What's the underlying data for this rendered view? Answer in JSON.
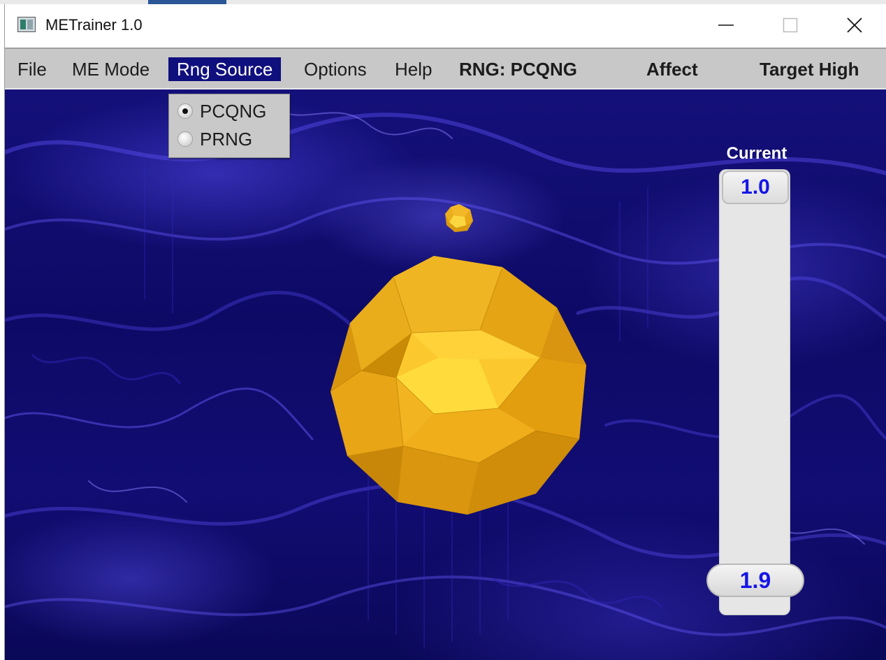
{
  "window": {
    "title": "METrainer 1.0"
  },
  "menu": {
    "items": [
      "File",
      "ME Mode",
      "Rng Source",
      "Options",
      "Help"
    ],
    "active": "Rng Source"
  },
  "status": {
    "rng": "RNG: PCQNG",
    "mode": "Affect",
    "target": "Target High"
  },
  "rng_source_menu": {
    "options": [
      {
        "label": "PCQNG",
        "selected": true
      },
      {
        "label": "PRNG",
        "selected": false
      }
    ]
  },
  "gauge": {
    "label": "Current",
    "current": "1.0",
    "target": "1.9"
  },
  "colors": {
    "menu_active_bg": "#0f0f7e",
    "gauge_text": "#1515e6",
    "orb": "#f5b820",
    "scene_bg": "#14107a"
  }
}
